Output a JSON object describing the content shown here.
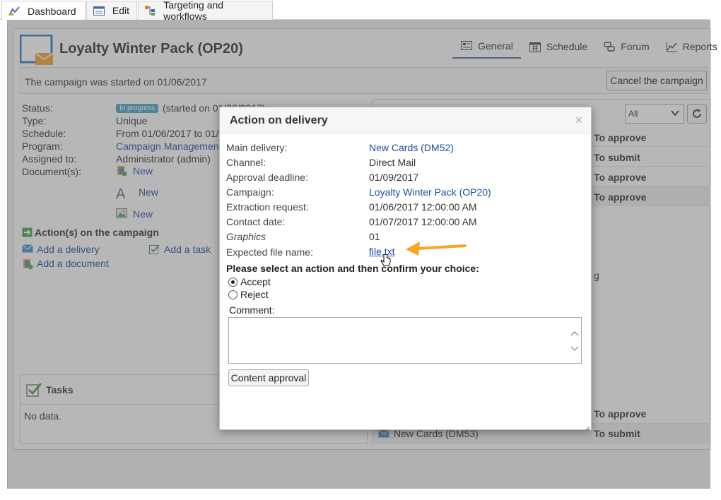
{
  "tabs": [
    {
      "label": "Dashboard",
      "icon": "dashboard-icon"
    },
    {
      "label": "Edit",
      "icon": "edit-form-icon"
    },
    {
      "label": "Targeting and workflows",
      "icon": "workflow-icon"
    }
  ],
  "campaign": {
    "title": "Loyalty Winter Pack (OP20)",
    "started_text": "The campaign was started on 01/06/2017",
    "cancel_label": "Cancel the campaign",
    "view_tabs": [
      "General",
      "Schedule",
      "Forum",
      "Reports"
    ]
  },
  "properties": {
    "status_label": "Status:",
    "status_badge": "In progress",
    "status_detail": "(started on 01/06/2017)",
    "type_label": "Type:",
    "type_value": "Unique",
    "schedule_label": "Schedule:",
    "schedule_value": "From 01/06/2017 to 01/11",
    "program_label": "Program:",
    "program_value": "Campaign Management >",
    "assigned_label": "Assigned to:",
    "assigned_value": "Administrator (admin)",
    "documents_label": "Document(s):",
    "doc_new_labels": [
      "New",
      "New",
      "New"
    ]
  },
  "actions": {
    "heading": "Action(s) on the campaign",
    "add_delivery": "Add a delivery",
    "add_task": "Add a task",
    "add_document": "Add a document"
  },
  "tasks": {
    "title": "Tasks",
    "empty": "No data."
  },
  "deliveries": {
    "filter_value": "All",
    "statuses_top": [
      "To approve",
      "To submit",
      "To approve",
      "To approve"
    ],
    "partial_link": "g",
    "statuses_bottom": [
      "To approve",
      "To submit"
    ],
    "bottom_delivery_name": "New Cards (DM53)"
  },
  "modal": {
    "title": "Action on delivery",
    "close": "×",
    "fields": {
      "main_delivery_label": "Main delivery:",
      "main_delivery_value": "New Cards (DM52)",
      "channel_label": "Channel:",
      "channel_value": "Direct Mail",
      "approval_deadline_label": "Approval deadline:",
      "approval_deadline_value": "01/09/2017",
      "campaign_label": "Campaign:",
      "campaign_value": "Loyalty Winter Pack (OP20)",
      "extraction_label": "Extraction request:",
      "extraction_value": "01/06/2017 12:00:00 AM",
      "contact_date_label": "Contact date:",
      "contact_date_value": "01/07/2017 12:00:00 AM",
      "graphics_label": "Graphics",
      "graphics_value": "01",
      "file_name_label": "Expected file name:",
      "file_name_value": "file.txt"
    },
    "prompt": "Please select an action and then confirm your choice:",
    "accept_label": "Accept",
    "reject_label": "Reject",
    "selected": "Accept",
    "comment_label": "Comment:",
    "comment_value": "",
    "approve_button": "Content approval"
  },
  "colors": {
    "accent": "#1d4e9e",
    "badge": "#4aa3c4",
    "arrow": "#f5a623"
  }
}
